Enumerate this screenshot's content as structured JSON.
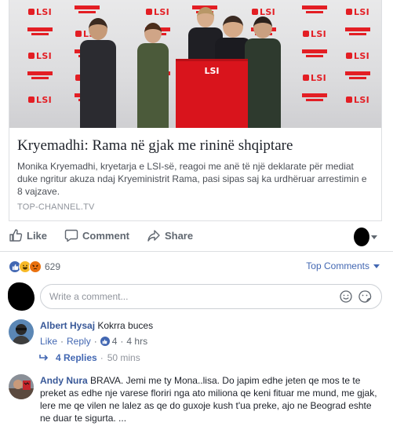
{
  "preview": {
    "image_logo": "LSI",
    "title": "Kryemadhi: Rama në gjak me rininë shqiptare",
    "description": "Monika Kryemadhi, kryetarja e LSI-së, reagoi me anë të një deklarate për mediat duke ngritur akuza ndaj Kryeministrit Rama, pasi sipas saj ka urdhëruar arrestimin e 8 vajzave.",
    "domain": "TOP-CHANNEL.TV"
  },
  "actions": {
    "like_label": "Like",
    "comment_label": "Comment",
    "share_label": "Share"
  },
  "reactions": {
    "count": "629",
    "types": [
      "like-icon",
      "haha-icon",
      "angry-icon"
    ]
  },
  "comment_sort": {
    "label": "Top Comments"
  },
  "composer": {
    "placeholder": "Write a comment..."
  },
  "comments": [
    {
      "author": "Albert Hysaj",
      "text": "Kokrra buces",
      "like_label": "Like",
      "reply_label": "Reply",
      "likes": "4",
      "time": "4 hrs",
      "replies_label": "4 Replies",
      "replies_time": "50 mins"
    },
    {
      "author": "Andy Nura",
      "text": "BRAVA. Jemi me ty Mona..lisa. Do japim edhe jeten qe mos te te preket as edhe nje varese floriri nga ato miliona qe keni fituar me mund, me gjak, lere me qe vilen ne lalez as qe do guxoje kush t'ua preke, ajo ne Beograd eshte ne duar te sigurta. ..."
    }
  ],
  "colors": {
    "link_blue": "#4267b2",
    "author_blue": "#385898",
    "lsi_red": "#e31e24"
  }
}
